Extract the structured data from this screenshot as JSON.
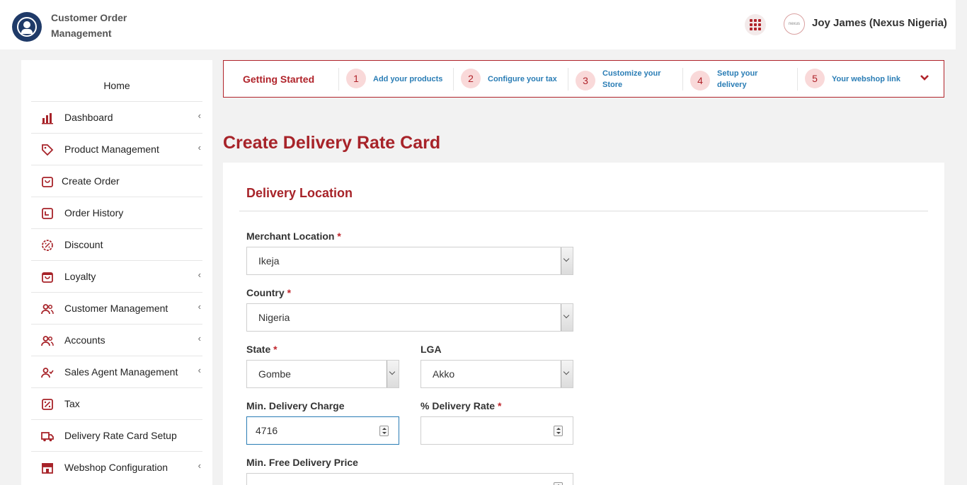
{
  "header": {
    "app_title": "Customer Order Management",
    "user_name": "Joy James (Nexus Nigeria)",
    "avatar_text": "nexus"
  },
  "sidebar": {
    "home_label": "Home",
    "items": [
      {
        "label": "Dashboard",
        "icon": "bar-chart-icon",
        "has_submenu": true
      },
      {
        "label": "Product Management",
        "icon": "tag-icon",
        "has_submenu": true
      },
      {
        "label": "Create Order",
        "icon": "shopping-bag-icon",
        "has_submenu": false
      },
      {
        "label": "Order History",
        "icon": "history-icon",
        "has_submenu": false
      },
      {
        "label": "Discount",
        "icon": "discount-badge-icon",
        "has_submenu": false
      },
      {
        "label": "Loyalty",
        "icon": "gift-icon",
        "has_submenu": true
      },
      {
        "label": "Customer Management",
        "icon": "users-icon",
        "has_submenu": true
      },
      {
        "label": "Accounts",
        "icon": "users-icon",
        "has_submenu": true
      },
      {
        "label": "Sales Agent Management",
        "icon": "user-check-icon",
        "has_submenu": true
      },
      {
        "label": "Tax",
        "icon": "percent-icon",
        "has_submenu": false
      },
      {
        "label": "Delivery Rate Card Setup",
        "icon": "truck-icon",
        "has_submenu": false
      },
      {
        "label": "Webshop Configuration",
        "icon": "store-icon",
        "has_submenu": true
      }
    ]
  },
  "getting_started": {
    "title": "Getting Started",
    "steps": [
      {
        "num": "1",
        "label": "Add your products"
      },
      {
        "num": "2",
        "label": "Configure your tax"
      },
      {
        "num": "3",
        "label": "Customize your Store"
      },
      {
        "num": "4",
        "label": "Setup your delivery"
      },
      {
        "num": "5",
        "label": "Your webshop link"
      }
    ]
  },
  "page": {
    "title": "Create Delivery Rate Card",
    "section_title": "Delivery Location"
  },
  "form": {
    "merchant_location": {
      "label": "Merchant Location",
      "required": "*",
      "value": "Ikeja"
    },
    "country": {
      "label": "Country",
      "required": "*",
      "value": "Nigeria"
    },
    "state": {
      "label": "State",
      "required": "*",
      "value": "Gombe"
    },
    "lga": {
      "label": "LGA",
      "value": "Akko"
    },
    "min_delivery_charge": {
      "label": "Min. Delivery Charge",
      "value": "4716"
    },
    "pct_delivery_rate": {
      "label": "% Delivery Rate",
      "required": "*",
      "value": ""
    },
    "min_free_delivery_price": {
      "label": "Min. Free Delivery Price",
      "value": ""
    }
  },
  "colors": {
    "brand": "#a72329",
    "accent_link": "#2a7db5",
    "step_badge": "#f9d9d9",
    "logo": "#1f3a68"
  }
}
